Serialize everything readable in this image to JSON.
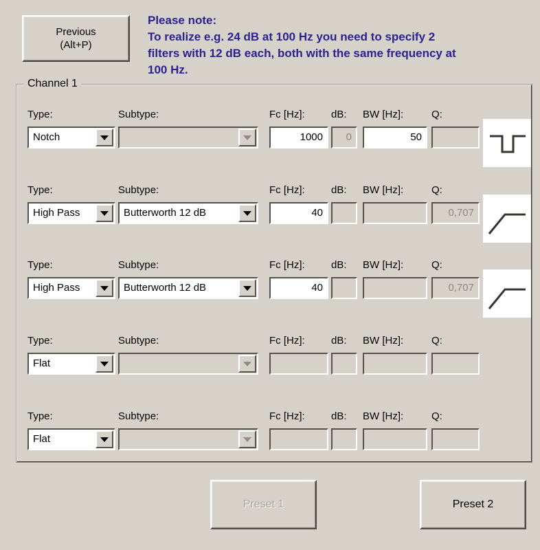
{
  "navigation": {
    "previous_label_line1": "Previous",
    "previous_label_line2": "(Alt+P)"
  },
  "note": {
    "heading": "Please note:",
    "line1": "To realize e.g. 24 dB at 100 Hz you need to specify 2",
    "line2": "filters with 12 dB each, both with the same frequency at",
    "line3": "100 Hz.",
    "color": "#2b2191"
  },
  "group": {
    "label": "Channel 1"
  },
  "column_labels": {
    "type": "Type:",
    "subtype": "Subtype:",
    "fc": "Fc [Hz]:",
    "db": "dB:",
    "bw": "BW [Hz]:",
    "q": "Q:"
  },
  "filters": [
    {
      "type": "Notch",
      "type_enabled": true,
      "subtype": "",
      "subtype_enabled": false,
      "fc": "1000",
      "fc_enabled": true,
      "db": "0",
      "db_enabled": false,
      "bw": "50",
      "bw_enabled": true,
      "q": "",
      "q_enabled": false,
      "icon": "notch-response-icon"
    },
    {
      "type": "High Pass",
      "type_enabled": true,
      "subtype": "Butterworth 12 dB",
      "subtype_enabled": true,
      "fc": "40",
      "fc_enabled": true,
      "db": "",
      "db_enabled": false,
      "bw": "",
      "bw_enabled": false,
      "q": "0,707",
      "q_enabled": false,
      "icon": "highpass-response-icon"
    },
    {
      "type": "High Pass",
      "type_enabled": true,
      "subtype": "Butterworth 12 dB",
      "subtype_enabled": true,
      "fc": "40",
      "fc_enabled": true,
      "db": "",
      "db_enabled": false,
      "bw": "",
      "bw_enabled": false,
      "q": "0,707",
      "q_enabled": false,
      "icon": "highpass-response-icon"
    },
    {
      "type": "Flat",
      "type_enabled": true,
      "subtype": "",
      "subtype_enabled": false,
      "fc": "",
      "fc_enabled": false,
      "db": "",
      "db_enabled": false,
      "bw": "",
      "bw_enabled": false,
      "q": "",
      "q_enabled": false,
      "icon": "none"
    },
    {
      "type": "Flat",
      "type_enabled": true,
      "subtype": "",
      "subtype_enabled": false,
      "fc": "",
      "fc_enabled": false,
      "db": "",
      "db_enabled": false,
      "bw": "",
      "bw_enabled": false,
      "q": "",
      "q_enabled": false,
      "icon": "none"
    }
  ],
  "presets": [
    {
      "label": "Preset 1",
      "enabled": false
    },
    {
      "label": "Preset 2",
      "enabled": true
    }
  ],
  "colors": {
    "window_background": "#d6d2ca",
    "field_background": "#ffffff",
    "disabled_text": "#8d8982",
    "note_text": "#2b2191"
  }
}
